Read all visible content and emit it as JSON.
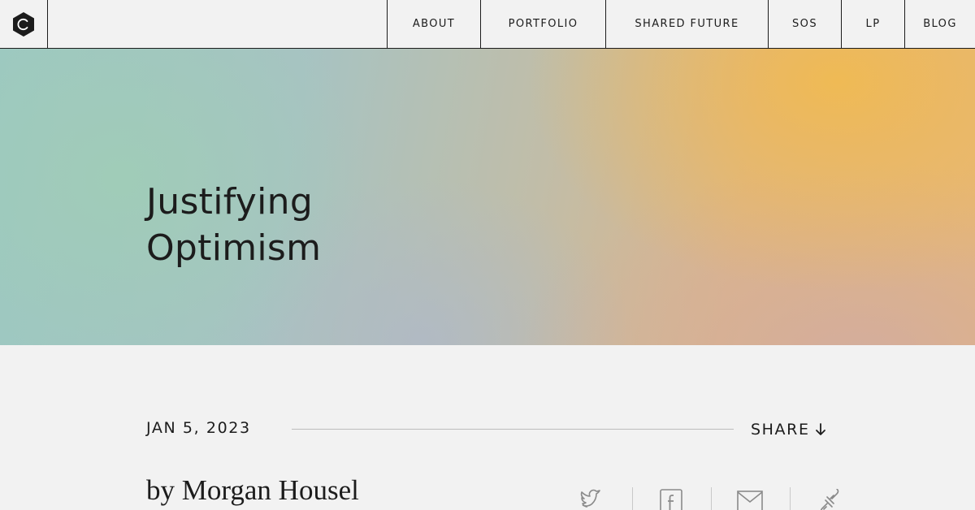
{
  "header": {
    "logo_icon": "hexagon-c-logo-icon",
    "nav": [
      {
        "label": "ABOUT"
      },
      {
        "label": "PORTFOLIO"
      },
      {
        "label": "SHARED FUTURE"
      },
      {
        "label": "SOS"
      },
      {
        "label": "LP"
      },
      {
        "label": "BLOG"
      }
    ]
  },
  "hero": {
    "title_line1": "Justifying",
    "title_line2": "Optimism"
  },
  "meta": {
    "date": "JAN 5, 2023",
    "share_label": "SHARE",
    "share_icon": "arrow-down-icon"
  },
  "byline": "by Morgan Housel",
  "share_icons": [
    "twitter-icon",
    "facebook-icon",
    "mail-icon",
    "link-icon"
  ],
  "colors": {
    "text": "#1c1c1c",
    "background": "#f2f2f2",
    "hero_teal": "#9cc8c2",
    "hero_gold": "#f0ba52",
    "divider": "#bdbdbd"
  }
}
